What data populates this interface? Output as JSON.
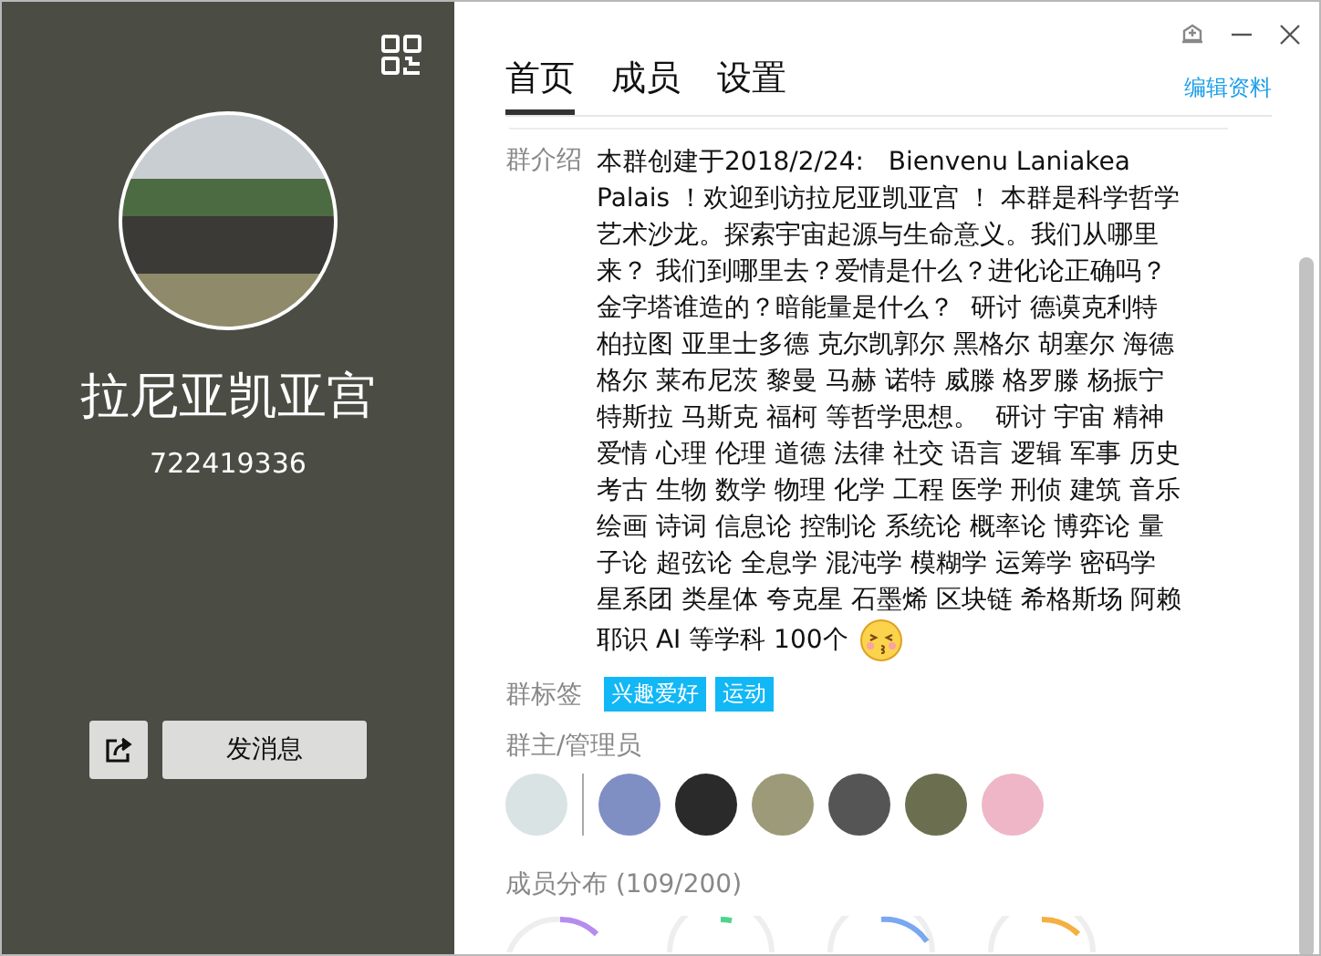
{
  "sidebar": {
    "group_name": "拉尼亚凯亚宫",
    "group_id": "722419336",
    "send_button": "发消息"
  },
  "tabs": [
    {
      "label": "首页",
      "selected": true
    },
    {
      "label": "成员",
      "selected": false
    },
    {
      "label": "设置",
      "selected": false
    }
  ],
  "edit_link": "编辑资料",
  "intro": {
    "label": "群介绍",
    "lines": [
      "本群创建于2018/2/24:   Bienvenu Laniakea",
      "Palais ！欢迎到访拉尼亚凯亚宫 ！ 本群是科学哲学",
      "艺术沙龙。探索宇宙起源与生命意义。我们从哪里",
      "来？ 我们到哪里去？爱情是什么？进化论正确吗？",
      "金字塔谁造的？暗能量是什么？  研讨 德谟克利特",
      "柏拉图 亚里士多德 克尔凯郭尔 黑格尔 胡塞尔 海德",
      "格尔 莱布尼茨 黎曼 马赫 诺特 威滕 格罗滕 杨振宁",
      "特斯拉 马斯克 福柯 等哲学思想。  研讨 宇宙 精神",
      "爱情 心理 伦理 道德 法律 社交 语言 逻辑 军事 历史",
      "考古 生物 数学 物理 化学 工程 医学 刑侦 建筑 音乐",
      "绘画 诗词 信息论 控制论 系统论 概率论 博弈论 量",
      "子论 超弦论 全息学 混沌学 模糊学 运筹学 密码学",
      "星系团 类星体 夸克星 石墨烯 区块链 希格斯场 阿赖",
      "耶识 AI 等学科 100个"
    ]
  },
  "tags": {
    "label": "群标签",
    "items": [
      "兴趣爱好",
      "运动"
    ]
  },
  "admins": {
    "label": "群主/管理员"
  },
  "distribution": {
    "label": "成员分布 (109/200)"
  }
}
